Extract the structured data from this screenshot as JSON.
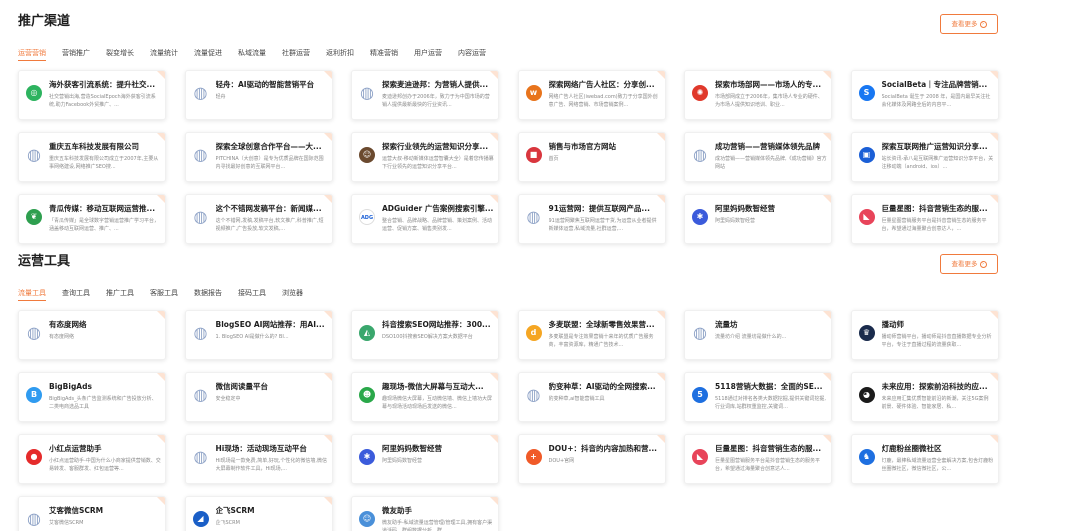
{
  "sections": [
    {
      "title": "推广渠道",
      "more_label": "查看更多",
      "tabs": [
        "运营营销",
        "营销推广",
        "裂变增长",
        "流量统计",
        "流量促进",
        "私域流量",
        "社群运营",
        "返利折扣",
        "精准营销",
        "用户运营",
        "内容运营"
      ],
      "cards": [
        {
          "title": "海外获客引流系统：提升社交...",
          "desc": "社交营销出海,营造SocialEpoch海外获客引流系统,助力Facebook外贸推广、...",
          "icon": "social-epoch-icon",
          "color": "#2db35f",
          "glyph": "◎"
        },
        {
          "title": "轻舟：AI驱动的智能营销平台",
          "desc": "轻舟",
          "icon": "globe-icon",
          "color": "#8fa3c7",
          "glyph": "◍"
        },
        {
          "title": "探索麦迪逊邦：为营销人提供...",
          "desc": "麦迪逊邦创办于2006年，致力于为中国市场的营销人提供最新最快的行业资讯...",
          "icon": "globe-icon",
          "color": "#8fa3c7",
          "glyph": "◍"
        },
        {
          "title": "探索网络广告人社区：分享创...",
          "desc": "网络广告人社区(iwebad.com)致力于分享国外创意广告、网络营销、市场营销案例...",
          "icon": "iwebad-icon",
          "color": "#e8741c",
          "glyph": "w"
        },
        {
          "title": "探索市场部网——市场人的专...",
          "desc": "市场部网成立于2006年，集市场人专业的硬件、为市场人提供知识培训、职业...",
          "icon": "shichangbu-icon",
          "color": "#e0392b",
          "glyph": "✺"
        },
        {
          "title": "SocialBeta｜专注品牌营销...",
          "desc": "SocialBeta 诞生于 2008 年，是国内最早关注社会化媒体及网路全后的内容平...",
          "icon": "socialbeta-icon",
          "color": "#1877f2",
          "glyph": "S"
        },
        {
          "title": "重庆五车科技发展有限公司",
          "desc": "重庆五车科技发展有限公司成立于2007年,主要从事网络建设,网络推广SEO搜...",
          "icon": "globe-icon",
          "color": "#8fa3c7",
          "glyph": "◍"
        },
        {
          "title": "探索全球创意合作平台——大...",
          "desc": "PITCHINA（大创意）是专为优质品牌在国际范围内寻找最好创意的互联网平台...",
          "icon": "globe-icon",
          "color": "#8fa3c7",
          "glyph": "◍"
        },
        {
          "title": "探索行业领先的运营知识分享...",
          "desc": "运营大叔-移动新媒体运营智囊大全）是着您传播篡下行业领先的运营知识分享平台...",
          "icon": "avatar-icon",
          "color": "#6b4a2f",
          "glyph": "☺"
        },
        {
          "title": "销售与市场官方网站",
          "desc": "首页",
          "icon": "square-icon",
          "color": "#d9363e",
          "glyph": "■"
        },
        {
          "title": "成功营销——营销媒体领先品牌",
          "desc": "成功营销——营销媒体领先品牌,《成功营销》官方网站",
          "icon": "globe-icon",
          "color": "#8fa3c7",
          "glyph": "◍"
        },
        {
          "title": "探索互联网推广运营知识分享...",
          "desc": "站长资讯-承八是互联网推广运营知识分享平台，关注移动端（android、ios）...",
          "icon": "window-icon",
          "color": "#1b5fd6",
          "glyph": "▣"
        },
        {
          "title": "青瓜传媒：移动互联网运营推...",
          "desc": "「青瓜传媒」是全球数字营销运营推广学习平台，涵盖移动互联网运营、推广、...",
          "icon": "qinggua-icon",
          "color": "#2e9f4f",
          "glyph": "❦"
        },
        {
          "title": "这个不错网发稿平台：新闻媒...",
          "desc": "这个不错网,发稿,发稿平台,软文推广,科普推广,短视频推广,广告投放,软文发稿,...",
          "icon": "globe-icon",
          "color": "#8fa3c7",
          "glyph": "◍"
        },
        {
          "title": "ADGuider 广告案例搜索引擎...",
          "desc": "整合营销、品牌战略、品牌营销、策划案例、活动运营、促销方案、销售类别发...",
          "icon": "adguider-icon",
          "color": "#ffffff",
          "glyph": "ADG"
        },
        {
          "title": "91运营网：提供互联网产品...",
          "desc": "91运营网聚焦互联网运营干货,为运营从业者提供新媒体运营,私域流量,社群运营,...",
          "icon": "globe-icon",
          "color": "#8fa3c7",
          "glyph": "◍"
        },
        {
          "title": "阿里妈妈数智经营",
          "desc": "阿里妈妈数智经营",
          "icon": "alimama-icon",
          "color": "#3b5bdb",
          "glyph": "✱"
        },
        {
          "title": "巨量星图：抖音营销生态的服...",
          "desc": "巨量星图营销服务平台是抖音营销生态的服务平台，希望通过海量聚合创意达人，...",
          "icon": "xingtu-icon",
          "color": "#e8445a",
          "glyph": "◣"
        }
      ]
    },
    {
      "title": "运营工具",
      "more_label": "查看更多",
      "tabs": [
        "流量工具",
        "查询工具",
        "推广工具",
        "客服工具",
        "数据报告",
        "接码工具",
        "浏览器"
      ],
      "cards": [
        {
          "title": "有态度网络",
          "desc": "有态度网络",
          "icon": "globe-icon",
          "color": "#8fa3c7",
          "glyph": "◍"
        },
        {
          "title": "BlogSEO AI网站推荐：用AI...",
          "desc": "1. BlogSEO AI是做什么的? BI...",
          "icon": "globe-icon",
          "color": "#8fa3c7",
          "glyph": "◍"
        },
        {
          "title": "抖音搜索SEO网站推荐：300...",
          "desc": "DSO100抖搜索SEO解决方案大数据平台",
          "icon": "dso-icon",
          "color": "#3aa76d",
          "glyph": "◭"
        },
        {
          "title": "多麦联盟：全球新零售效果营...",
          "desc": "多麦联盟是专注效果营销十来年的优质广告服务商，丰富资源库，精通广告技术...",
          "icon": "duomai-icon",
          "color": "#f5a623",
          "glyph": "d"
        },
        {
          "title": "流量坊",
          "desc": "流量坊介绍 流量坊是做什么的...",
          "icon": "globe-icon",
          "color": "#8fa3c7",
          "glyph": "◍"
        },
        {
          "title": "播动师",
          "desc": "播动师营销平台，播动师是抖音直播数据专业分析平台，专注于直播过程的流量获取...",
          "icon": "bodongshi-icon",
          "color": "#1a2b4c",
          "glyph": "♛"
        },
        {
          "title": "BigBigAds",
          "desc": "BigBigAds_头条广告监测系统和广告投放分析、二类电商选品工具",
          "icon": "bigbigads-icon",
          "color": "#2f9bf0",
          "glyph": "B"
        },
        {
          "title": "微信阅读量平台",
          "desc": "安全稳定中",
          "icon": "globe-icon",
          "color": "#8fa3c7",
          "glyph": "◍"
        },
        {
          "title": "趣现场-微信大屏幕与互动大...",
          "desc": "趣现场微信大屏幕，互动微信墙、微信上墙功大屏幕与现场活动现场后发送的微信...",
          "icon": "quxianchang-icon",
          "color": "#2aa84a",
          "glyph": "☻"
        },
        {
          "title": "豹变种草：AI驱动的全网搜索...",
          "desc": "豹变种草,ai智能营销工具",
          "icon": "globe-icon",
          "color": "#8fa3c7",
          "glyph": "◍"
        },
        {
          "title": "5118营销大数据：全面的SE...",
          "desc": "5118通过对排名各类大数据挖掘,提供关键词挖掘,行业词库,站群权重监控,关键词...",
          "icon": "icon-5118",
          "color": "#1e6fe0",
          "glyph": "5"
        },
        {
          "title": "未来应用：探索前沿科技的应...",
          "desc": "未来应用汇集优质智能前沿的新潮，关注5G案例前景、硬件体验、智能家居、私...",
          "icon": "weilai-icon",
          "color": "#1b1b1b",
          "glyph": "◕"
        },
        {
          "title": "小红点运营助手",
          "desc": "小红点运营助手-中国为什么小商家提供营销数、交易转发、客服群发、红包运营等...",
          "icon": "xiaohongdian-icon",
          "color": "#e52b2b",
          "glyph": "●"
        },
        {
          "title": "Hi现场：活动现场互动平台",
          "desc": "Hi现场是一款免费,简单,好玩,个性化的微信墙,微信大屏幕制作软件工具，Hi现场,...",
          "icon": "globe-icon",
          "color": "#8fa3c7",
          "glyph": "◍"
        },
        {
          "title": "阿里妈妈数智经营",
          "desc": "阿里妈妈数智经营",
          "icon": "alimama-icon",
          "color": "#3b5bdb",
          "glyph": "✱"
        },
        {
          "title": "DOU+：抖音的内容加热和营...",
          "desc": "DOU+官网",
          "icon": "dou-icon",
          "color": "#f05a28",
          "glyph": "+"
        },
        {
          "title": "巨量星图：抖音营销生态的服...",
          "desc": "巨量星图营销服务平台是抖音营销生态的服务平台，希望通过海量聚合创意达人...",
          "icon": "xingtu-icon",
          "color": "#e8445a",
          "glyph": "◣"
        },
        {
          "title": "灯鹿粉丝圈微社区",
          "desc": "灯鹿，最棒私域流量运营全套解决方案,包含灯鹿粉丝圈微社区，微信微社区，公...",
          "icon": "denglu-icon",
          "color": "#1e6fe0",
          "glyph": "♞"
        },
        {
          "title": "艾客微信SCRM",
          "desc": "艾客微信SCRM",
          "icon": "globe-icon",
          "color": "#8fa3c7",
          "glyph": "◍"
        },
        {
          "title": "企飞SCRM",
          "desc": "企飞SCRM",
          "icon": "qifei-icon",
          "color": "#1a5fc7",
          "glyph": "◢"
        },
        {
          "title": "微友助手",
          "desc": "微友助手-私域流量运营管理/管理工具,拥有客户渠道活码、群组数据分析、群...",
          "icon": "weiyou-icon",
          "color": "#4a90d9",
          "glyph": "☺"
        }
      ]
    }
  ]
}
